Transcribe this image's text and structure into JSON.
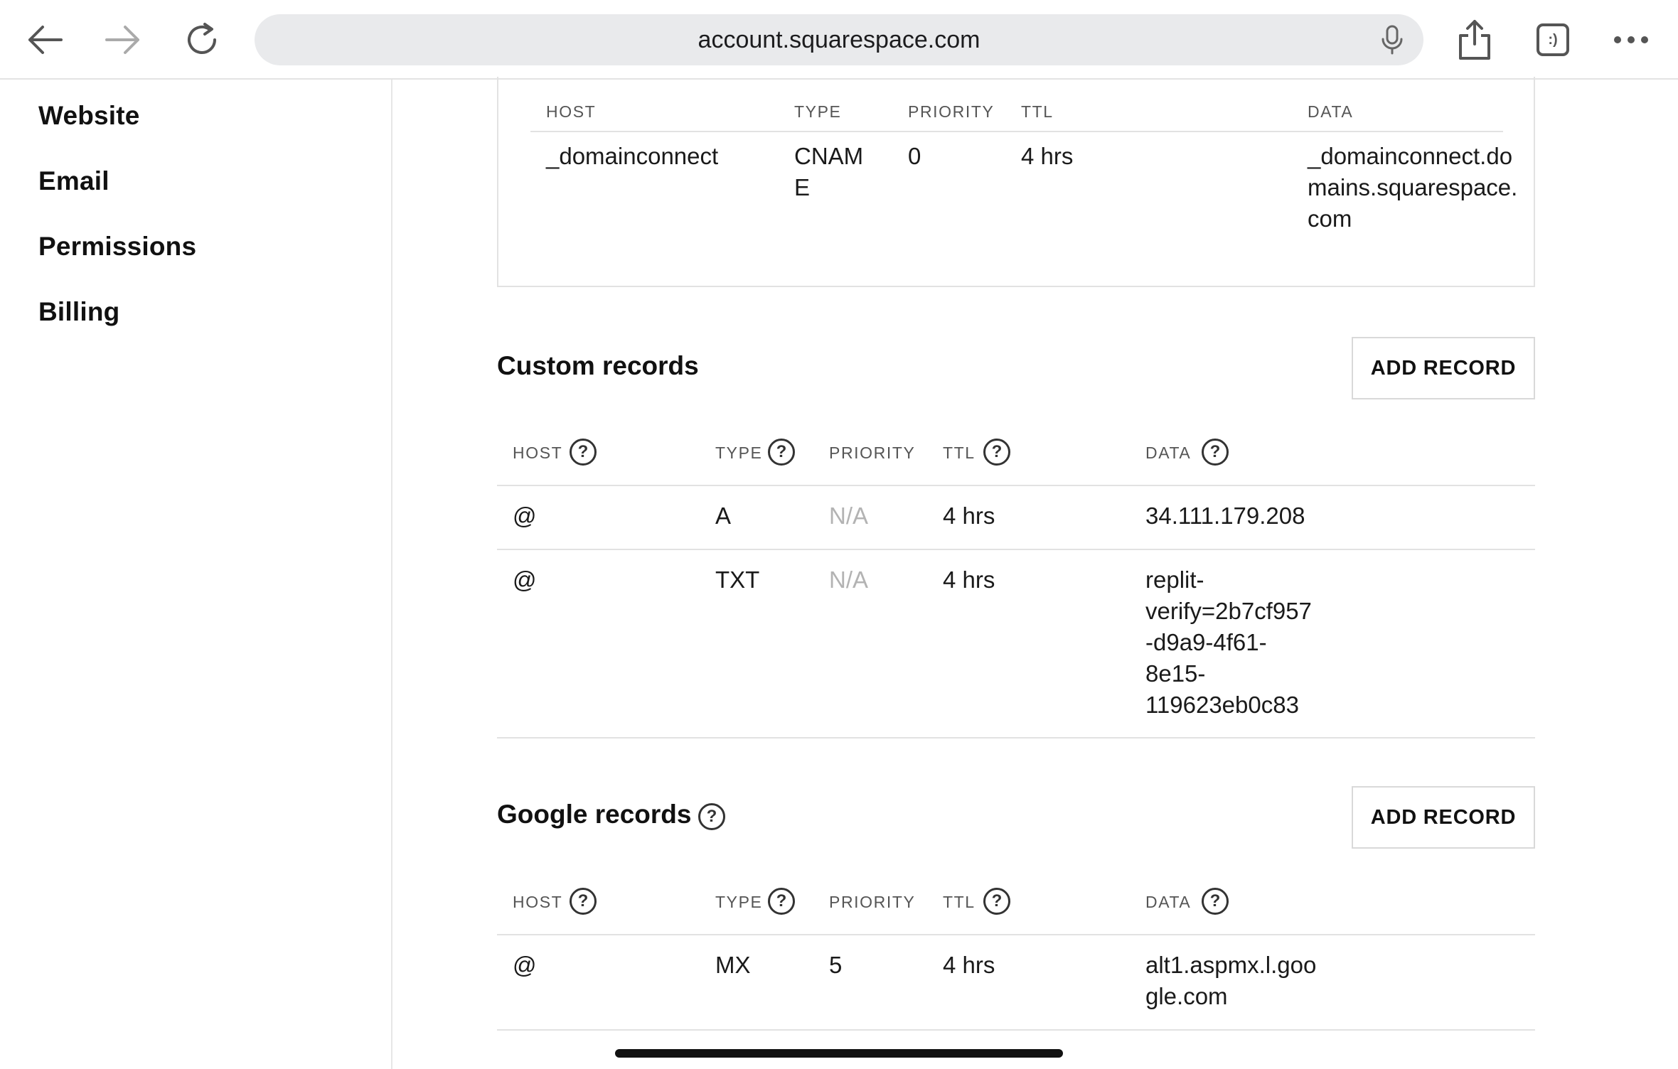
{
  "browser": {
    "url": "account.squarespace.com",
    "tab_count_label": ":)"
  },
  "sidebar": {
    "items": [
      {
        "label": "Website"
      },
      {
        "label": "Email"
      },
      {
        "label": "Permissions"
      },
      {
        "label": "Billing"
      }
    ]
  },
  "top_table": {
    "headers": [
      "HOST",
      "TYPE",
      "PRIORITY",
      "TTL",
      "DATA"
    ],
    "row": {
      "host": "_domainconnect",
      "type_l1": "CNAM",
      "type_l2": "E",
      "priority": "0",
      "ttl": "4 hrs",
      "data_l1": "_domainconnect.do",
      "data_l2": "mains.squarespace.",
      "data_l3": "com"
    }
  },
  "custom_records": {
    "title": "Custom records",
    "add_button": "ADD RECORD",
    "headers": [
      "HOST",
      "TYPE",
      "PRIORITY",
      "TTL",
      "DATA"
    ],
    "rows": [
      {
        "host": "@",
        "type": "A",
        "priority": "N/A",
        "ttl": "4 hrs",
        "data": [
          "34.111.179.208"
        ]
      },
      {
        "host": "@",
        "type": "TXT",
        "priority": "N/A",
        "ttl": "4 hrs",
        "data": [
          "replit-",
          "verify=2b7cf957",
          "-d9a9-4f61-",
          "8e15-",
          "119623eb0c83"
        ]
      }
    ]
  },
  "google_records": {
    "title": "Google records",
    "add_button": "ADD RECORD",
    "headers": [
      "HOST",
      "TYPE",
      "PRIORITY",
      "TTL",
      "DATA"
    ],
    "rows": [
      {
        "host": "@",
        "type": "MX",
        "priority": "5",
        "ttl": "4 hrs",
        "data": [
          "alt1.aspmx.l.goo",
          "gle.com"
        ]
      }
    ]
  },
  "help_glyph": "?"
}
